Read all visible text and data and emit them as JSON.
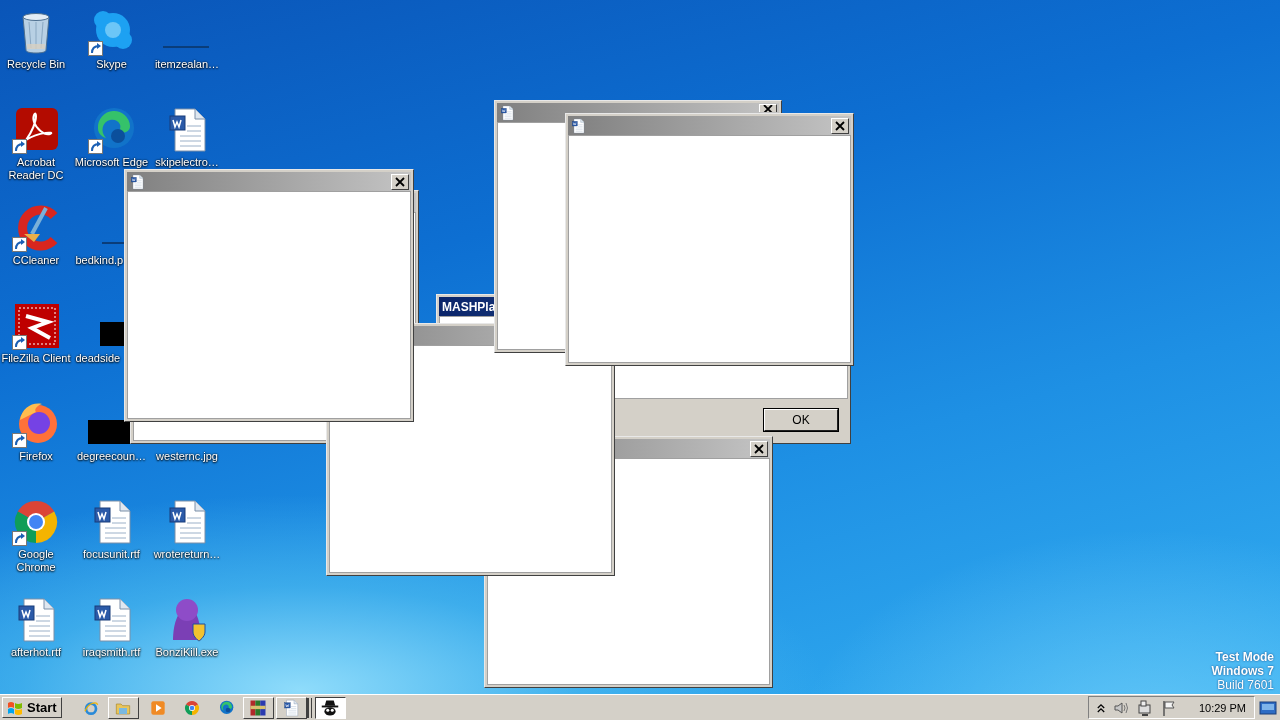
{
  "desktop_icons": [
    {
      "label": "Recycle Bin",
      "kind": "recycle"
    },
    {
      "label": "Acrobat\nReader DC",
      "kind": "acrobat"
    },
    {
      "label": "CCleaner",
      "kind": "ccleaner"
    },
    {
      "label": "FileZilla Client",
      "kind": "filezilla"
    },
    {
      "label": "Firefox",
      "kind": "firefox"
    },
    {
      "label": "Google\nChrome",
      "kind": "chrome"
    },
    {
      "label": "afterhot.rtf",
      "kind": "word"
    },
    {
      "label": "Skype",
      "kind": "skype"
    },
    {
      "label": "Microsoft Edge",
      "kind": "edge"
    },
    {
      "label": "bedkind.p",
      "kind": "thumb_line"
    },
    {
      "label": "deadside",
      "kind": "thumb_black"
    },
    {
      "label": "degreecoun…",
      "kind": "thumb_black"
    },
    {
      "label": "focusunit.rtf",
      "kind": "word"
    },
    {
      "label": "iraqsmith.rtf",
      "kind": "word"
    },
    {
      "label": "itemzealan…",
      "kind": "thumb_line"
    },
    {
      "label": "skipelectro…",
      "kind": "word"
    },
    {
      "label": "westernc.jpg",
      "kind": "covered"
    },
    {
      "label": "wrotereturn…",
      "kind": "word"
    },
    {
      "label": "BonziKill.exe",
      "kind": "bonzi"
    }
  ],
  "windows": [
    {
      "kind": "dialog",
      "title": "MASHPla",
      "button": "OK"
    },
    {
      "kind": "blank"
    },
    {
      "kind": "blank"
    },
    {
      "kind": "blank"
    },
    {
      "kind": "blank"
    },
    {
      "kind": "blank"
    },
    {
      "kind": "blank"
    }
  ],
  "os_notice": [
    "Test Mode",
    "Windows 7",
    "Build 7601"
  ],
  "taskbar": {
    "start": "Start",
    "quick_launch": [
      {
        "kind": "ie"
      },
      {
        "kind": "folder"
      },
      {
        "kind": "media"
      },
      {
        "kind": "chrome"
      },
      {
        "kind": "edge"
      }
    ],
    "tasks": [
      {
        "kind": "archive",
        "selected": false
      },
      {
        "kind": "word",
        "selected": false
      },
      {
        "kind": "bonzi",
        "selected": true
      }
    ],
    "clock": "10:29 PM"
  }
}
